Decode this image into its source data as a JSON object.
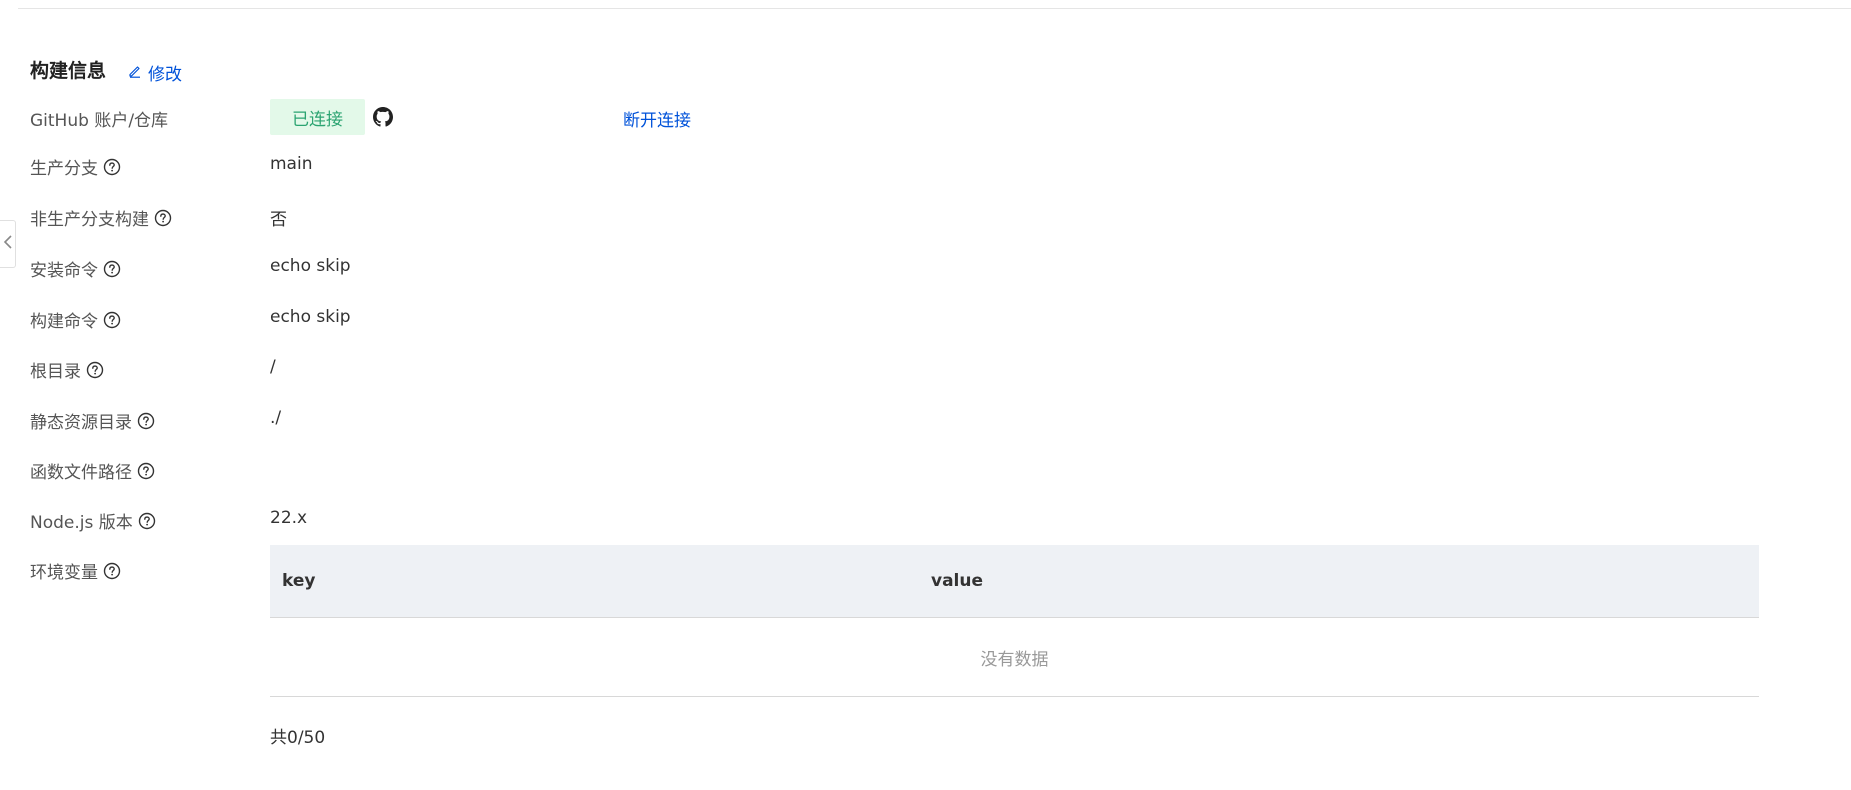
{
  "section": {
    "title": "构建信息",
    "edit_label": "修改"
  },
  "github": {
    "label": "GitHub 账户/仓库",
    "status": "已连接",
    "disconnect_label": "断开连接"
  },
  "rows": [
    {
      "label": "生产分支",
      "value": "main"
    },
    {
      "label": "非生产分支构建",
      "value": "否"
    },
    {
      "label": "安装命令",
      "value": "echo skip"
    },
    {
      "label": "构建命令",
      "value": "echo skip"
    },
    {
      "label": "根目录",
      "value": "/"
    },
    {
      "label": "静态资源目录",
      "value": "./"
    },
    {
      "label": "函数文件路径",
      "value": ""
    },
    {
      "label": "Node.js 版本",
      "value": "22.x"
    }
  ],
  "env": {
    "label": "环境变量",
    "columns": [
      "key",
      "value"
    ],
    "empty_text": "没有数据",
    "total_text": "共0/50"
  },
  "colors": {
    "link": "#0052d9",
    "success_bg": "#e3f9e9",
    "success_text": "#2ba471",
    "table_header_bg": "#eef1f5"
  },
  "icons": {
    "edit": "edit-icon",
    "github": "github-icon",
    "help": "help-circle-icon",
    "collapse": "chevron-left-icon"
  }
}
